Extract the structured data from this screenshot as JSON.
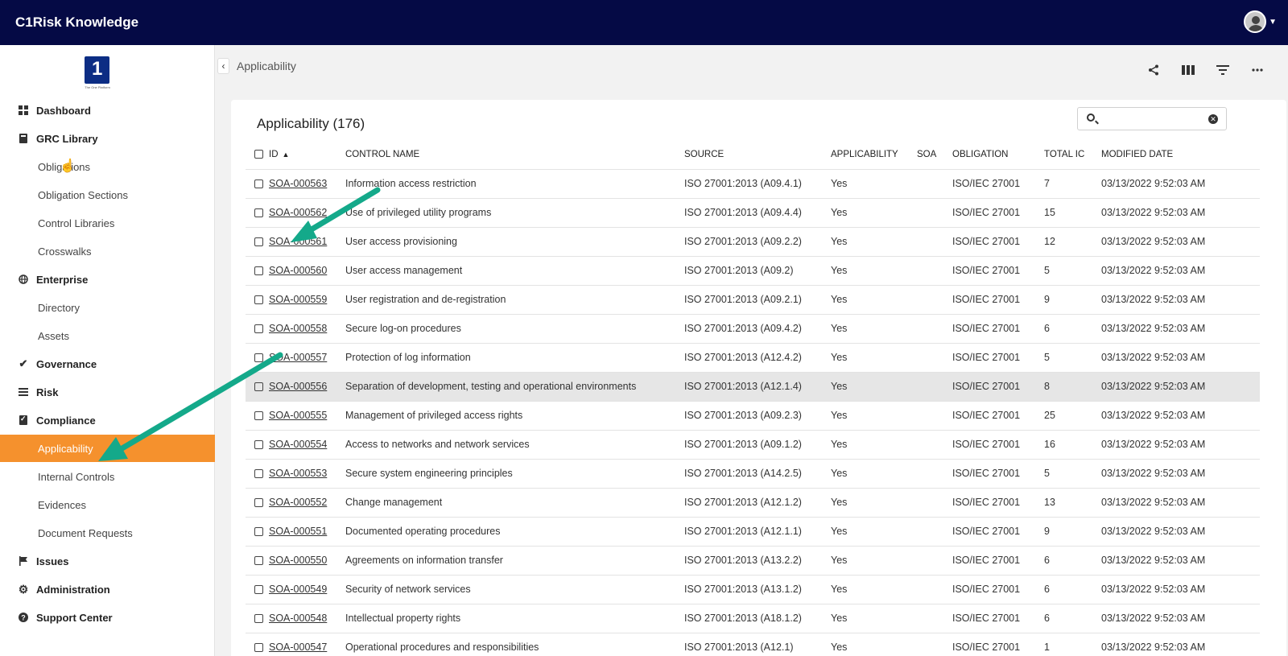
{
  "app": {
    "title": "C1Risk Knowledge"
  },
  "sidebar": {
    "logo_glyph": "1",
    "logo_caption": "The One Platform",
    "items": [
      {
        "label": "Dashboard",
        "level": "top",
        "icon": "dashboard-grid-icon"
      },
      {
        "label": "GRC Library",
        "level": "top",
        "icon": "book-icon"
      },
      {
        "label": "Obligations",
        "level": "sub"
      },
      {
        "label": "Obligation Sections",
        "level": "sub"
      },
      {
        "label": "Control Libraries",
        "level": "sub"
      },
      {
        "label": "Crosswalks",
        "level": "sub"
      },
      {
        "label": "Enterprise",
        "level": "top",
        "icon": "globe-icon"
      },
      {
        "label": "Directory",
        "level": "sub"
      },
      {
        "label": "Assets",
        "level": "sub"
      },
      {
        "label": "Governance",
        "level": "top",
        "icon": "double-check-icon"
      },
      {
        "label": "Risk",
        "level": "top",
        "icon": "list-icon"
      },
      {
        "label": "Compliance",
        "level": "top",
        "icon": "clipboard-check-icon"
      },
      {
        "label": "Applicability",
        "level": "sub",
        "active": true
      },
      {
        "label": "Internal Controls",
        "level": "sub"
      },
      {
        "label": "Evidences",
        "level": "sub"
      },
      {
        "label": "Document Requests",
        "level": "sub"
      },
      {
        "label": "Issues",
        "level": "top",
        "icon": "flag-icon"
      },
      {
        "label": "Administration",
        "level": "top",
        "icon": "gear-icon"
      },
      {
        "label": "Support Center",
        "level": "top",
        "icon": "help-circle-icon"
      }
    ]
  },
  "breadcrumb": {
    "current": "Applicability"
  },
  "card": {
    "title": "Applicability (176)",
    "search_placeholder": "",
    "columns": [
      "ID",
      "CONTROL NAME",
      "SOURCE",
      "APPLICABILITY",
      "SOA",
      "OBLIGATION",
      "TOTAL IC",
      "MODIFIED DATE"
    ],
    "sort": {
      "column": "ID",
      "direction": "ascending"
    },
    "rows": [
      [
        "SOA-000563",
        "Information access restriction",
        "ISO 27001:2013 (A09.4.1)",
        "Yes",
        "",
        "ISO/IEC 27001",
        "7",
        "03/13/2022 9:52:03 AM"
      ],
      [
        "SOA-000562",
        "Use of privileged utility programs",
        "ISO 27001:2013 (A09.4.4)",
        "Yes",
        "",
        "ISO/IEC 27001",
        "15",
        "03/13/2022 9:52:03 AM"
      ],
      [
        "SOA-000561",
        "User access provisioning",
        "ISO 27001:2013 (A09.2.2)",
        "Yes",
        "",
        "ISO/IEC 27001",
        "12",
        "03/13/2022 9:52:03 AM"
      ],
      [
        "SOA-000560",
        "User access management",
        "ISO 27001:2013 (A09.2)",
        "Yes",
        "",
        "ISO/IEC 27001",
        "5",
        "03/13/2022 9:52:03 AM"
      ],
      [
        "SOA-000559",
        "User registration and de-registration",
        "ISO 27001:2013 (A09.2.1)",
        "Yes",
        "",
        "ISO/IEC 27001",
        "9",
        "03/13/2022 9:52:03 AM"
      ],
      [
        "SOA-000558",
        "Secure log-on procedures",
        "ISO 27001:2013 (A09.4.2)",
        "Yes",
        "",
        "ISO/IEC 27001",
        "6",
        "03/13/2022 9:52:03 AM"
      ],
      [
        "SOA-000557",
        "Protection of log information",
        "ISO 27001:2013 (A12.4.2)",
        "Yes",
        "",
        "ISO/IEC 27001",
        "5",
        "03/13/2022 9:52:03 AM"
      ],
      [
        "SOA-000556",
        "Separation of development, testing and operational environments",
        "ISO 27001:2013 (A12.1.4)",
        "Yes",
        "",
        "ISO/IEC 27001",
        "8",
        "03/13/2022 9:52:03 AM"
      ],
      [
        "SOA-000555",
        "Management of privileged access rights",
        "ISO 27001:2013 (A09.2.3)",
        "Yes",
        "",
        "ISO/IEC 27001",
        "25",
        "03/13/2022 9:52:03 AM"
      ],
      [
        "SOA-000554",
        "Access to networks and network services",
        "ISO 27001:2013 (A09.1.2)",
        "Yes",
        "",
        "ISO/IEC 27001",
        "16",
        "03/13/2022 9:52:03 AM"
      ],
      [
        "SOA-000553",
        "Secure system engineering principles",
        "ISO 27001:2013 (A14.2.5)",
        "Yes",
        "",
        "ISO/IEC 27001",
        "5",
        "03/13/2022 9:52:03 AM"
      ],
      [
        "SOA-000552",
        "Change management",
        "ISO 27001:2013 (A12.1.2)",
        "Yes",
        "",
        "ISO/IEC 27001",
        "13",
        "03/13/2022 9:52:03 AM"
      ],
      [
        "SOA-000551",
        "Documented operating procedures",
        "ISO 27001:2013 (A12.1.1)",
        "Yes",
        "",
        "ISO/IEC 27001",
        "9",
        "03/13/2022 9:52:03 AM"
      ],
      [
        "SOA-000550",
        "Agreements on information transfer",
        "ISO 27001:2013 (A13.2.2)",
        "Yes",
        "",
        "ISO/IEC 27001",
        "6",
        "03/13/2022 9:52:03 AM"
      ],
      [
        "SOA-000549",
        "Security of network services",
        "ISO 27001:2013 (A13.1.2)",
        "Yes",
        "",
        "ISO/IEC 27001",
        "6",
        "03/13/2022 9:52:03 AM"
      ],
      [
        "SOA-000548",
        "Intellectual property rights",
        "ISO 27001:2013 (A18.1.2)",
        "Yes",
        "",
        "ISO/IEC 27001",
        "6",
        "03/13/2022 9:52:03 AM"
      ],
      [
        "SOA-000547",
        "Operational procedures and responsibilities",
        "ISO 27001:2013 (A12.1)",
        "Yes",
        "",
        "ISO/IEC 27001",
        "1",
        "03/13/2022 9:52:03 AM"
      ]
    ],
    "highlighted_row": 7
  },
  "colors": {
    "topbar": "#050a45",
    "accent": "#f5912d",
    "annotation_arrow": "#14a98a"
  }
}
